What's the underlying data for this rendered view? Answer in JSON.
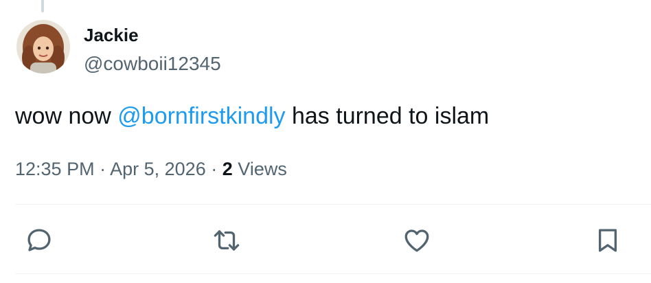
{
  "author": {
    "display_name": "Jackie",
    "handle": "@cowboii12345",
    "avatar_icon": "avatar-illustration-icon"
  },
  "tweet": {
    "text_before": "wow now ",
    "mention": "@bornfirstkindly",
    "text_after": " has turned to islam"
  },
  "meta": {
    "time": "12:35 PM",
    "separator": "·",
    "date": "Apr 5, 2026",
    "views_count": "2",
    "views_label": "Views"
  },
  "actions": [
    {
      "name": "reply",
      "icon": "reply-icon"
    },
    {
      "name": "retweet",
      "icon": "retweet-icon"
    },
    {
      "name": "like",
      "icon": "heart-icon"
    },
    {
      "name": "bookmark",
      "icon": "bookmark-icon"
    }
  ],
  "colors": {
    "link": "#1d9bf0",
    "secondary_text": "#536471",
    "primary_text": "#0f1419",
    "divider": "#eff3f4"
  }
}
